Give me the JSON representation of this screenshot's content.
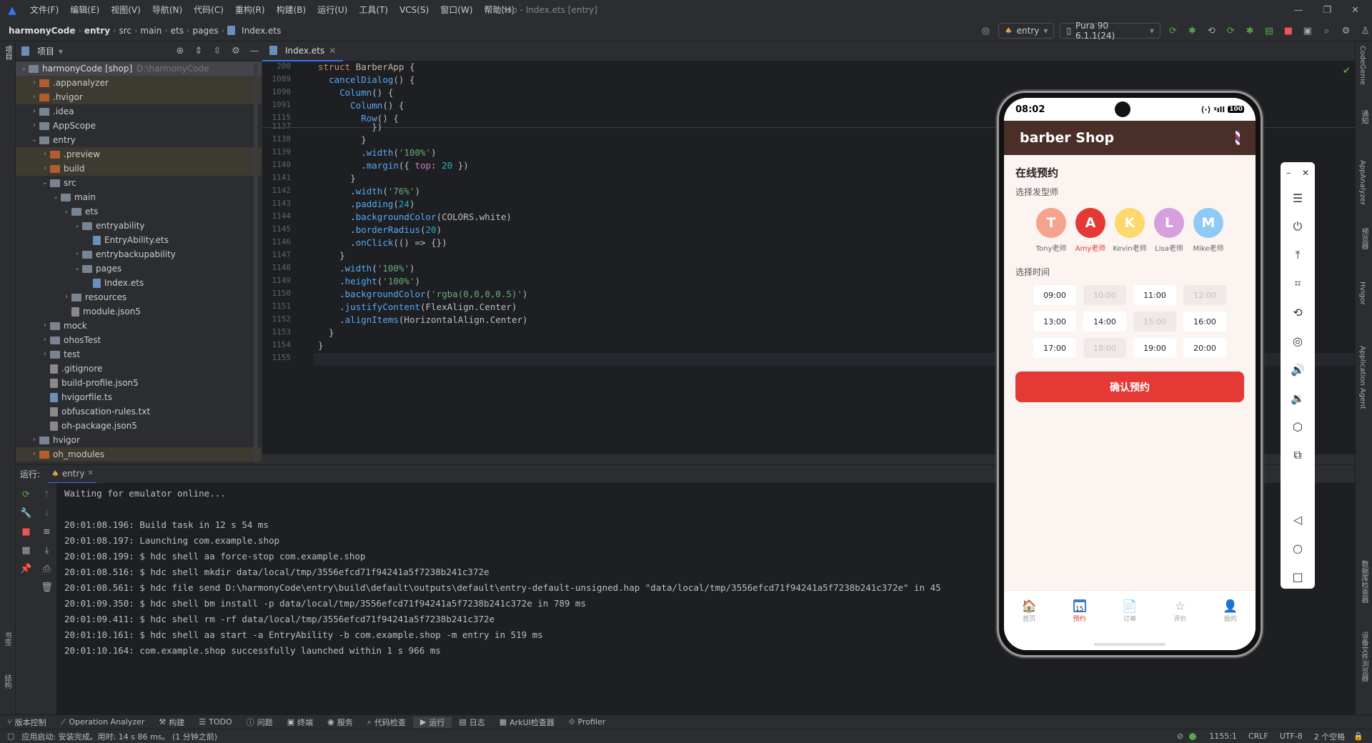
{
  "menu": [
    "文件(F)",
    "编辑(E)",
    "视图(V)",
    "导航(N)",
    "代码(C)",
    "重构(R)",
    "构建(B)",
    "运行(U)",
    "工具(T)",
    "VCS(S)",
    "窗口(W)",
    "帮助(H)"
  ],
  "window_title": "shop - Index.ets [entry]",
  "breadcrumb": {
    "project": "harmonyCode",
    "module": "entry",
    "p1": "src",
    "p2": "main",
    "p3": "ets",
    "p4": "pages",
    "file": "Index.ets"
  },
  "run_config": "entry",
  "device": "Pura 90 6.1.1(24)",
  "project_panel": {
    "title": "项目",
    "root_name": "harmonyCode [shop]",
    "root_path": "D:\\harmonyCode",
    "items": [
      {
        "label": ".appanalyzer",
        "depth": 1,
        "type": "folder-orange",
        "arrow": "›"
      },
      {
        "label": ".hvigor",
        "depth": 1,
        "type": "folder-orange",
        "arrow": "›"
      },
      {
        "label": ".idea",
        "depth": 1,
        "type": "folder",
        "arrow": "›"
      },
      {
        "label": "AppScope",
        "depth": 1,
        "type": "folder",
        "arrow": "›"
      },
      {
        "label": "entry",
        "depth": 1,
        "type": "folder",
        "arrow": "⌄"
      },
      {
        "label": ".preview",
        "depth": 2,
        "type": "folder-orange",
        "arrow": "›"
      },
      {
        "label": "build",
        "depth": 2,
        "type": "folder-orange",
        "arrow": "›"
      },
      {
        "label": "src",
        "depth": 2,
        "type": "folder",
        "arrow": "⌄"
      },
      {
        "label": "main",
        "depth": 3,
        "type": "folder",
        "arrow": "⌄"
      },
      {
        "label": "ets",
        "depth": 4,
        "type": "folder",
        "arrow": "⌄"
      },
      {
        "label": "entryability",
        "depth": 5,
        "type": "folder",
        "arrow": "⌄"
      },
      {
        "label": "EntryAbility.ets",
        "depth": 6,
        "type": "file",
        "arrow": ""
      },
      {
        "label": "entrybackupability",
        "depth": 5,
        "type": "folder",
        "arrow": "›"
      },
      {
        "label": "pages",
        "depth": 5,
        "type": "folder",
        "arrow": "⌄"
      },
      {
        "label": "Index.ets",
        "depth": 6,
        "type": "file",
        "arrow": ""
      },
      {
        "label": "resources",
        "depth": 4,
        "type": "folder",
        "arrow": "›"
      },
      {
        "label": "module.json5",
        "depth": 4,
        "type": "file-g",
        "arrow": ""
      },
      {
        "label": "mock",
        "depth": 2,
        "type": "folder",
        "arrow": "›"
      },
      {
        "label": "ohosTest",
        "depth": 2,
        "type": "folder",
        "arrow": "›"
      },
      {
        "label": "test",
        "depth": 2,
        "type": "folder",
        "arrow": "›"
      },
      {
        "label": ".gitignore",
        "depth": 2,
        "type": "file-g",
        "arrow": ""
      },
      {
        "label": "build-profile.json5",
        "depth": 2,
        "type": "file-g",
        "arrow": ""
      },
      {
        "label": "hvigorfile.ts",
        "depth": 2,
        "type": "file",
        "arrow": ""
      },
      {
        "label": "obfuscation-rules.txt",
        "depth": 2,
        "type": "file-g",
        "arrow": ""
      },
      {
        "label": "oh-package.json5",
        "depth": 2,
        "type": "file-g",
        "arrow": ""
      },
      {
        "label": "hvigor",
        "depth": 1,
        "type": "folder",
        "arrow": "›"
      },
      {
        "label": "oh_modules",
        "depth": 1,
        "type": "folder-orange",
        "arrow": "›"
      }
    ]
  },
  "editor": {
    "tab": "Index.ets",
    "sticky": [
      {
        "ln": "200",
        "html": "<span class='kw'>struct</span> <span class='ty'>BarberApp</span> {"
      },
      {
        "ln": "1089",
        "html": "  <span class='fn'>cancelDialog</span>() {"
      },
      {
        "ln": "1090",
        "html": "    <span class='fn'>Column</span>() {"
      },
      {
        "ln": "1091",
        "html": "      <span class='fn'>Column</span>() {"
      },
      {
        "ln": "1115",
        "html": "        <span class='fn'>Row</span>() {"
      }
    ],
    "lines": [
      {
        "ln": "1137",
        "html": "          })"
      },
      {
        "ln": "1138",
        "html": "        }"
      },
      {
        "ln": "1139",
        "html": "        .<span class='fn'>width</span>(<span class='st'>'100%'</span>)"
      },
      {
        "ln": "1140",
        "html": "        .<span class='fn'>margin</span>({ <span class='pr'>top</span>: <span class='nm'>20</span> })"
      },
      {
        "ln": "1141",
        "html": "      }"
      },
      {
        "ln": "1142",
        "html": "      .<span class='fn'>width</span>(<span class='st'>'76%'</span>)"
      },
      {
        "ln": "1143",
        "html": "      .<span class='fn'>padding</span>(<span class='nm'>24</span>)"
      },
      {
        "ln": "1144",
        "html": "      .<span class='fn'>backgroundColor</span>(COLORS.white)"
      },
      {
        "ln": "1145",
        "html": "      .<span class='fn'>borderRadius</span>(<span class='nm'>20</span>)"
      },
      {
        "ln": "1146",
        "html": "      .<span class='fn'>onClick</span>(() => {})"
      },
      {
        "ln": "1147",
        "html": "    }"
      },
      {
        "ln": "1148",
        "html": "    .<span class='fn'>width</span>(<span class='st'>'100%'</span>)"
      },
      {
        "ln": "1149",
        "html": "    .<span class='fn'>height</span>(<span class='st'>'100%'</span>)"
      },
      {
        "ln": "1150",
        "html": "    .<span class='fn'>backgroundColor</span>(<span class='st'>'rgba(0,0,0,0.5)'</span>)"
      },
      {
        "ln": "1151",
        "html": "    .<span class='fn'>justifyContent</span>(FlexAlign.Center)"
      },
      {
        "ln": "1152",
        "html": "    .<span class='fn'>alignItems</span>(HorizontalAlign.Center)"
      },
      {
        "ln": "1153",
        "html": "  }"
      },
      {
        "ln": "1154",
        "html": "}"
      },
      {
        "ln": "1155",
        "html": ""
      }
    ]
  },
  "run": {
    "label": "运行:",
    "tab": "entry",
    "lines": [
      "Waiting for emulator online...",
      "",
      "20:01:08.196: Build task in 12 s 54 ms",
      "20:01:08.197: Launching com.example.shop",
      "20:01:08.199: $ hdc shell aa force-stop com.example.shop",
      "20:01:08.516: $ hdc shell mkdir data/local/tmp/3556efcd71f94241a5f7238b241c372e",
      "20:01:08.561: $ hdc file send D:\\harmonyCode\\entry\\build\\default\\outputs\\default\\entry-default-unsigned.hap \"data/local/tmp/3556efcd71f94241a5f7238b241c372e\" in 45",
      "20:01:09.350: $ hdc shell bm install -p data/local/tmp/3556efcd71f94241a5f7238b241c372e in 789 ms",
      "20:01:09.411: $ hdc shell rm -rf data/local/tmp/3556efcd71f94241a5f7238b241c372e",
      "20:01:10.161: $ hdc shell aa start -a EntryAbility -b com.example.shop -m entry in 519 ms",
      "20:01:10.164: com.example.shop successfully launched within 1 s 966 ms"
    ]
  },
  "bottom_tools": [
    "版本控制",
    "Operation Analyzer",
    "构建",
    "TODO",
    "问题",
    "终端",
    "服务",
    "代码检查",
    "运行",
    "日志",
    "ArkUI检查器",
    "Profiler"
  ],
  "status": {
    "message": "应用启动: 安装完成。用时: 14 s 86 ms。 (1 分钟之前)",
    "position": "1155:1",
    "line_sep": "CRLF",
    "encoding": "UTF-8",
    "indent": "2 个空格"
  },
  "right_strip": [
    "CodeGenie",
    "通知",
    "AppAnalyzer",
    "预览器",
    "Hvigor",
    "Application Agent",
    "数据库检查器",
    "设备文件浏览器"
  ],
  "left_strip": [
    "项目",
    "书签",
    "结构"
  ],
  "phone": {
    "time": "08:02",
    "battery": "100",
    "app_title": "barber Shop",
    "section_title": "在线预约",
    "barber_label": "选择发型师",
    "barbers": [
      {
        "initial": "T",
        "name": "Tony老师",
        "color": "#f5a38c",
        "active": false
      },
      {
        "initial": "A",
        "name": "Amy老师",
        "color": "#e53935",
        "active": true
      },
      {
        "initial": "K",
        "name": "Kevin老师",
        "color": "#fdd86a",
        "active": false
      },
      {
        "initial": "L",
        "name": "Lisa老师",
        "color": "#d7a0dd",
        "active": false
      },
      {
        "initial": "M",
        "name": "Mike老师",
        "color": "#8ecaf5",
        "active": false
      }
    ],
    "time_label": "选择时间",
    "slots": [
      {
        "t": "09:00",
        "disabled": false
      },
      {
        "t": "10:00",
        "disabled": true
      },
      {
        "t": "11:00",
        "disabled": false
      },
      {
        "t": "12:00",
        "disabled": true
      },
      {
        "t": "13:00",
        "disabled": false
      },
      {
        "t": "14:00",
        "disabled": false
      },
      {
        "t": "15:00",
        "disabled": true
      },
      {
        "t": "16:00",
        "disabled": false
      },
      {
        "t": "17:00",
        "disabled": false
      },
      {
        "t": "18:00",
        "disabled": true
      },
      {
        "t": "19:00",
        "disabled": false
      },
      {
        "t": "20:00",
        "disabled": false
      }
    ],
    "confirm": "确认预约",
    "tabs": [
      {
        "label": "首页",
        "icon": "🏠",
        "active": false
      },
      {
        "label": "预约",
        "icon": "15",
        "active": true
      },
      {
        "label": "订单",
        "icon": "📄",
        "active": false
      },
      {
        "label": "评价",
        "icon": "☆",
        "active": false
      },
      {
        "label": "我的",
        "icon": "👤",
        "active": false
      }
    ]
  },
  "emulator_tools": [
    "menu-icon",
    "power-icon",
    "pin-top-icon",
    "crop-icon",
    "rotate-icon",
    "screenshot-icon",
    "volume-up-icon",
    "volume-down-icon",
    "shake-icon",
    "multi-screen-icon",
    "back-icon",
    "home-icon",
    "recents-icon"
  ]
}
